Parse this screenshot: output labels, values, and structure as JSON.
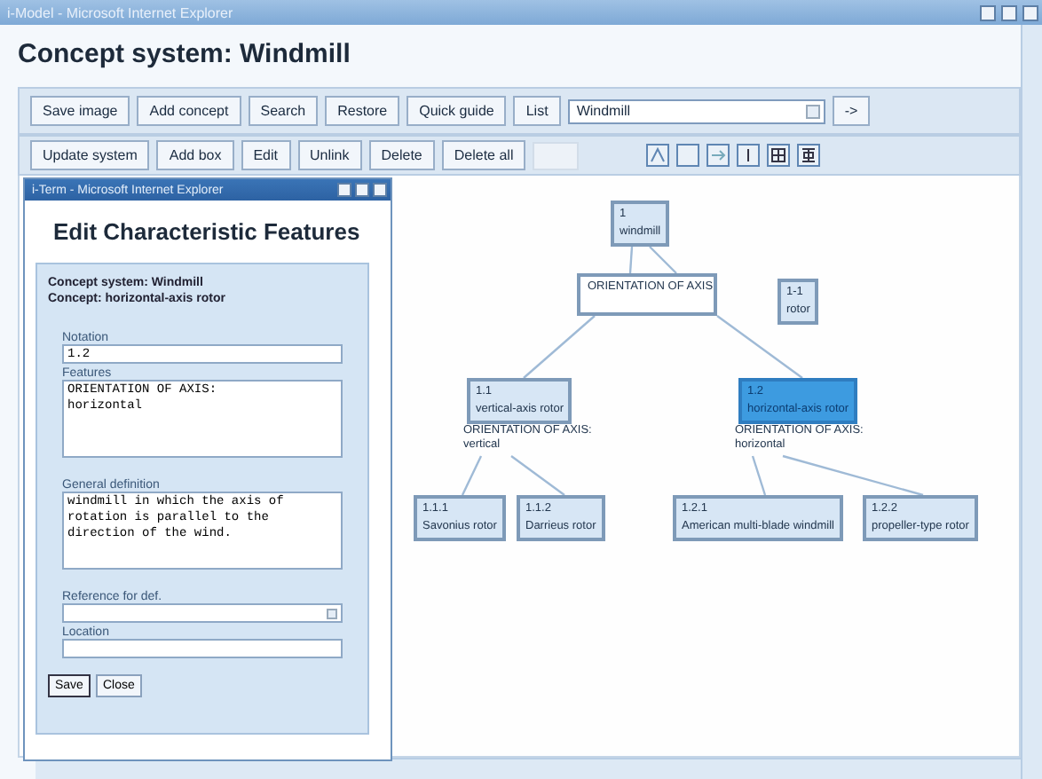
{
  "window": {
    "title": "i-Model - Microsoft Internet Explorer"
  },
  "page_title": "Concept system: Windmill",
  "toolbar": {
    "buttons": [
      "Save image",
      "Add concept",
      "Search",
      "Restore",
      "Quick guide",
      "List"
    ],
    "concept_select": {
      "value": "Windmill"
    },
    "go_button": "->"
  },
  "edit_toolbar": {
    "buttons": [
      "Update system",
      "Add box",
      "Edit",
      "Unlink",
      "Delete",
      "Delete all"
    ],
    "blank_button": {
      "disabled": true
    }
  },
  "popup": {
    "title": "i-Term - Microsoft Internet Explorer",
    "heading": "Edit Characteristic Features",
    "concept_system": "Concept system: Windmill",
    "concept": "Concept: horizontal-axis rotor",
    "fields": [
      {
        "kind": "input",
        "label": "Notation",
        "value": "1.2"
      },
      {
        "kind": "textarea",
        "label": "Features",
        "value": "ORIENTATION OF AXIS:\nhorizontal"
      },
      {
        "kind": "textarea",
        "label": "General definition",
        "value": "windmill in which the axis of rotation is parallel to the direction of the wind."
      },
      {
        "kind": "select",
        "label": "Reference for def."
      },
      {
        "kind": "input",
        "label": "Location"
      }
    ],
    "buttons": [
      "Save",
      "Close"
    ]
  },
  "diagram": {
    "nodes": [
      {
        "notation": "1",
        "term": "windmill",
        "selected": false,
        "criterion": "ORIENTATION OF AXIS",
        "children": [
          {
            "notation": "1.1",
            "term": "vertical-axis rotor",
            "selected": false,
            "feature": "ORIENTATION OF AXIS:\nvertical",
            "children": [
              {
                "notation": "1.1.1",
                "term": "Savonius rotor",
                "selected": false
              },
              {
                "notation": "1.1.2",
                "term": "Darrieus rotor",
                "selected": false
              }
            ]
          },
          {
            "notation": "1.2",
            "term": "horizontal-axis rotor",
            "selected": true,
            "feature": "ORIENTATION OF AXIS:\nhorizontal",
            "children": [
              {
                "notation": "1.2.1",
                "term": "American multi-blade windmill",
                "selected": false
              },
              {
                "notation": "1.2.2",
                "term": "propeller-type rotor",
                "selected": false
              }
            ]
          }
        ]
      }
    ],
    "loose_nodes": [
      {
        "notation": "1-1",
        "term": "rotor",
        "selected": false
      }
    ]
  }
}
